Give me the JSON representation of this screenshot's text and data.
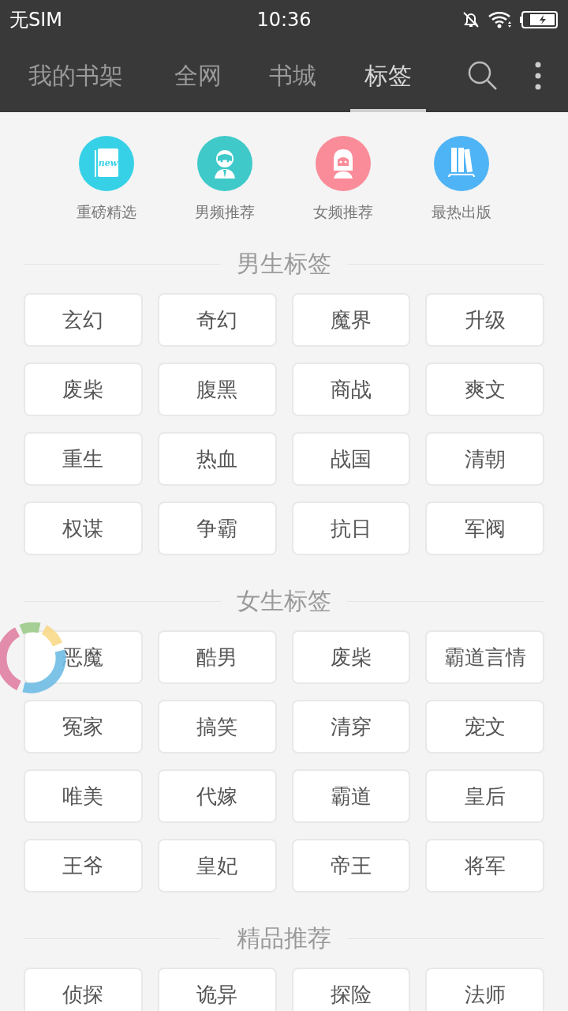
{
  "status_bar": {
    "carrier": "无SIM",
    "time": "10:36"
  },
  "tabs": [
    {
      "label": "我的书架",
      "selected": false
    },
    {
      "label": "全网",
      "selected": false
    },
    {
      "label": "书城",
      "selected": false
    },
    {
      "label": "标签",
      "selected": true
    }
  ],
  "categories": [
    {
      "label": "重磅精选",
      "kind": "book",
      "icon_text": "new"
    },
    {
      "label": "男频推荐",
      "kind": "boy"
    },
    {
      "label": "女频推荐",
      "kind": "girl"
    },
    {
      "label": "最热出版",
      "kind": "shelf"
    }
  ],
  "sections": [
    {
      "title": "男生标签",
      "tags": [
        "玄幻",
        "奇幻",
        "魔界",
        "升级",
        "废柴",
        "腹黑",
        "商战",
        "爽文",
        "重生",
        "热血",
        "战国",
        "清朝",
        "权谋",
        "争霸",
        "抗日",
        "军阀"
      ]
    },
    {
      "title": "女生标签",
      "tags": [
        "恶魔",
        "酷男",
        "废柴",
        "霸道言情",
        "冤家",
        "搞笑",
        "清穿",
        "宠文",
        "唯美",
        "代嫁",
        "霸道",
        "皇后",
        "王爷",
        "皇妃",
        "帝王",
        "将军"
      ]
    },
    {
      "title": "精品推荐",
      "tags": [
        "侦探",
        "诡异",
        "探险",
        "法师"
      ]
    }
  ]
}
